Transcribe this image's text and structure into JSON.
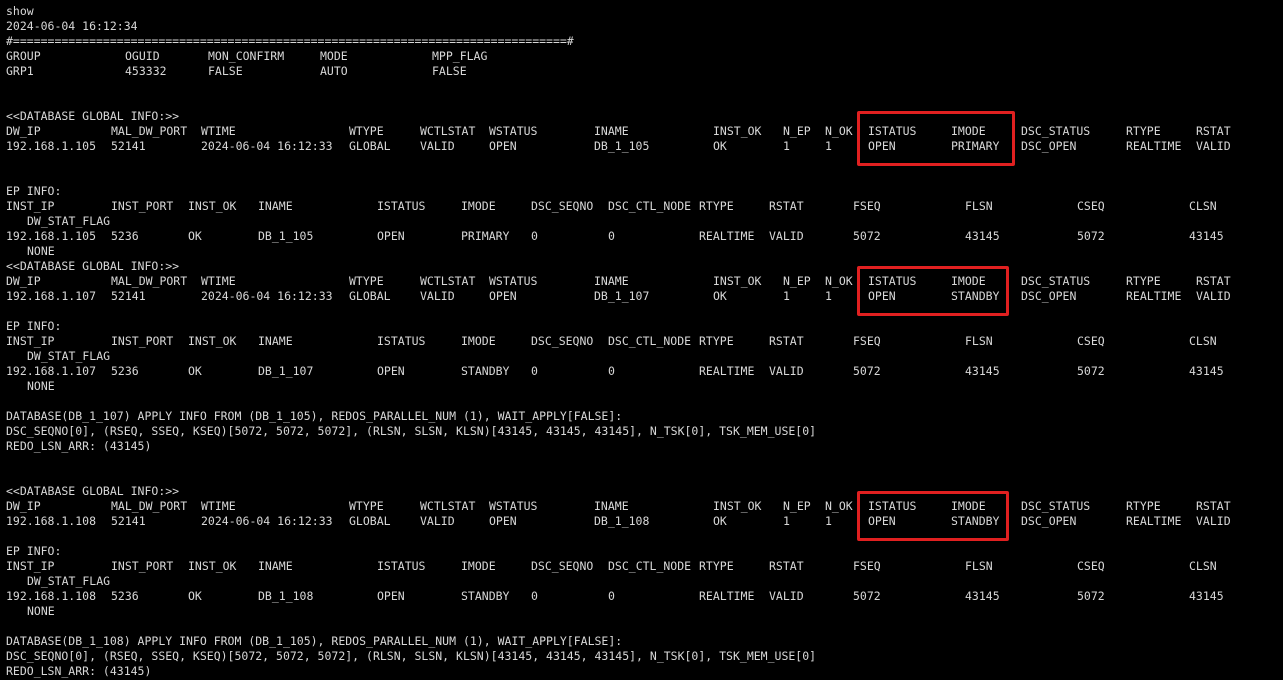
{
  "header": {
    "command": "show",
    "timestamp": "2024-06-04 16:12:34",
    "separator": "#================================================================================#"
  },
  "group": {
    "headers": [
      "GROUP",
      "OGUID",
      "MON_CONFIRM",
      "MODE",
      "MPP_FLAG"
    ],
    "values": [
      "GRP1",
      "453332",
      "FALSE",
      "AUTO",
      "FALSE"
    ]
  },
  "global_headers": [
    "DW_IP",
    "MAL_DW_PORT",
    "WTIME",
    "WTYPE",
    "WCTLSTAT",
    "WSTATUS",
    "INAME",
    "INST_OK",
    "N_EP",
    "N_OK",
    "ISTATUS",
    "IMODE",
    "DSC_STATUS",
    "RTYPE",
    "RSTAT"
  ],
  "ep_headers": [
    "INST_IP",
    "INST_PORT",
    "INST_OK",
    "INAME",
    "ISTATUS",
    "IMODE",
    "DSC_SEQNO",
    "DSC_CTL_NODE",
    "RTYPE",
    "RSTAT",
    "FSEQ",
    "FLSN",
    "CSEQ",
    "CLSN"
  ],
  "ep_header_wrap": "DW_STAT_FLAG",
  "sections": [
    {
      "global_title": "<<DATABASE GLOBAL INFO:>>",
      "global_row": [
        "192.168.1.105",
        "52141",
        "2024-06-04 16:12:33",
        "GLOBAL",
        "VALID",
        "OPEN",
        "DB_1_105",
        "OK",
        "1",
        "1",
        "OPEN",
        "PRIMARY",
        "DSC_OPEN",
        "REALTIME",
        "VALID"
      ],
      "ep_title": "EP INFO:",
      "ep_row": [
        "192.168.1.105",
        "5236",
        "OK",
        "DB_1_105",
        "OPEN",
        "PRIMARY",
        "0",
        "0",
        "REALTIME",
        "VALID",
        "5072",
        "43145",
        "5072",
        "43145"
      ],
      "ep_flag": "NONE",
      "apply": []
    },
    {
      "global_title": "<<DATABASE GLOBAL INFO:>>",
      "global_row": [
        "192.168.1.107",
        "52141",
        "2024-06-04 16:12:33",
        "GLOBAL",
        "VALID",
        "OPEN",
        "DB_1_107",
        "OK",
        "1",
        "1",
        "OPEN",
        "STANDBY",
        "DSC_OPEN",
        "REALTIME",
        "VALID"
      ],
      "ep_title": "EP INFO:",
      "ep_row": [
        "192.168.1.107",
        "5236",
        "OK",
        "DB_1_107",
        "OPEN",
        "STANDBY",
        "0",
        "0",
        "REALTIME",
        "VALID",
        "5072",
        "43145",
        "5072",
        "43145"
      ],
      "ep_flag": "NONE",
      "apply": [
        "DATABASE(DB_1_107) APPLY INFO FROM (DB_1_105), REDOS_PARALLEL_NUM (1), WAIT_APPLY[FALSE]:",
        "DSC_SEQNO[0], (RSEQ, SSEQ, KSEQ)[5072, 5072, 5072], (RLSN, SLSN, KLSN)[43145, 43145, 43145], N_TSK[0], TSK_MEM_USE[0]",
        "REDO_LSN_ARR: (43145)"
      ]
    },
    {
      "global_title": "<<DATABASE GLOBAL INFO:>>",
      "global_row": [
        "192.168.1.108",
        "52141",
        "2024-06-04 16:12:33",
        "GLOBAL",
        "VALID",
        "OPEN",
        "DB_1_108",
        "OK",
        "1",
        "1",
        "OPEN",
        "STANDBY",
        "DSC_OPEN",
        "REALTIME",
        "VALID"
      ],
      "ep_title": "EP INFO:",
      "ep_row": [
        "192.168.1.108",
        "5236",
        "OK",
        "DB_1_108",
        "OPEN",
        "STANDBY",
        "0",
        "0",
        "REALTIME",
        "VALID",
        "5072",
        "43145",
        "5072",
        "43145"
      ],
      "ep_flag": "NONE",
      "apply": [
        "DATABASE(DB_1_108) APPLY INFO FROM (DB_1_105), REDOS_PARALLEL_NUM (1), WAIT_APPLY[FALSE]:",
        "DSC_SEQNO[0], (RSEQ, SSEQ, KSEQ)[5072, 5072, 5072], (RLSN, SLSN, KLSN)[43145, 43145, 43145], N_TSK[0], TSK_MEM_USE[0]",
        "REDO_LSN_ARR: (43145)"
      ]
    }
  ],
  "colors": {
    "background": "#000000",
    "text": "#d8d8d8",
    "highlight": "#e02020"
  }
}
